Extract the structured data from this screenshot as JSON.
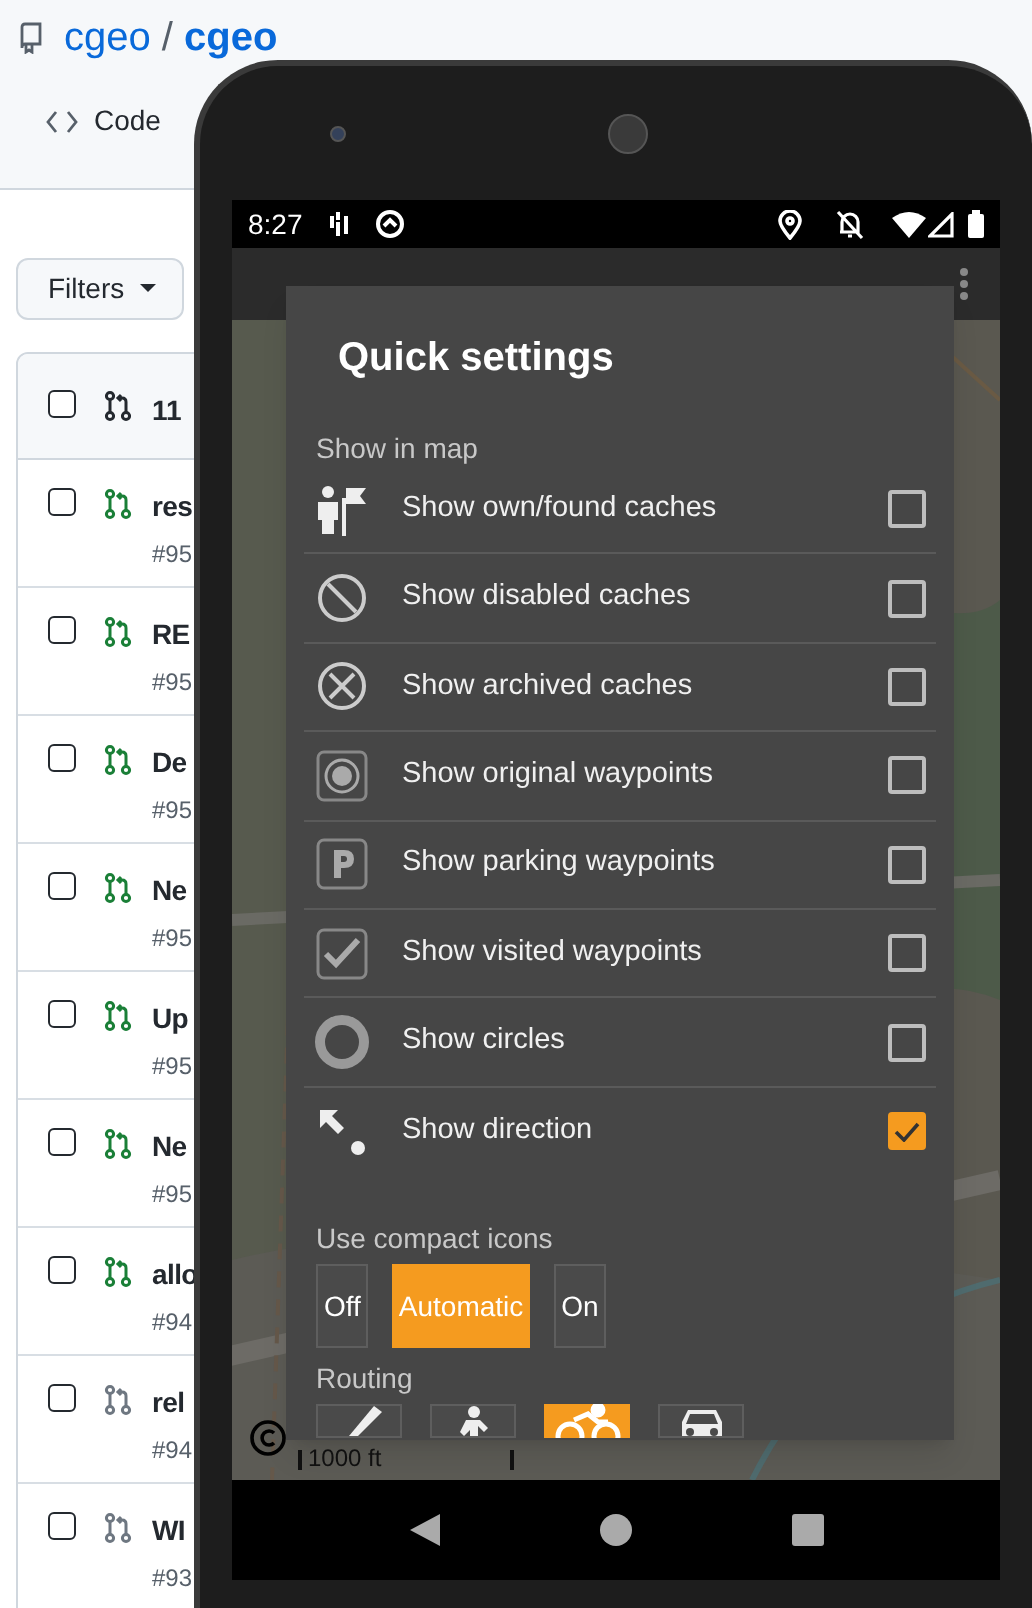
{
  "repo": {
    "owner": "cgeo",
    "separator": "/",
    "name": "cgeo"
  },
  "repo_tab": "Code",
  "filters_button": "Filters",
  "pull_requests": {
    "header": {
      "text": "11",
      "checked": false
    },
    "rows": [
      {
        "title": "res",
        "number": "#95",
        "kind": "open",
        "checked": false
      },
      {
        "title": "RE",
        "number": "#95",
        "kind": "open",
        "checked": false
      },
      {
        "title": "De",
        "number": "#95",
        "kind": "open",
        "checked": false
      },
      {
        "title": "Ne",
        "number": "#95",
        "kind": "open",
        "checked": false
      },
      {
        "title": "Up",
        "number": "#95",
        "kind": "open",
        "checked": false
      },
      {
        "title": "Ne",
        "number": "#95",
        "kind": "open",
        "checked": false
      },
      {
        "title": "allo",
        "number": "#94",
        "kind": "open",
        "checked": false
      },
      {
        "title": "rel",
        "number": "#94",
        "kind": "draft",
        "checked": false
      },
      {
        "title": "WI",
        "number": "#93",
        "kind": "draft",
        "checked": false
      }
    ]
  },
  "phone": {
    "status_bar": {
      "time": "8:27"
    },
    "map": {
      "scale": "1000 ft"
    },
    "dialog": {
      "title": "Quick settings",
      "section": "Show in map",
      "items": [
        {
          "kind": "own",
          "label": "Show own/found caches",
          "checked": false
        },
        {
          "kind": "disabled",
          "label": "Show disabled caches",
          "checked": false
        },
        {
          "kind": "archived",
          "label": "Show archived caches",
          "checked": false
        },
        {
          "kind": "original",
          "label": "Show original waypoints",
          "checked": false
        },
        {
          "kind": "parking",
          "label": "Show parking waypoints",
          "checked": false
        },
        {
          "kind": "visited",
          "label": "Show visited waypoints",
          "checked": false
        },
        {
          "kind": "circles",
          "label": "Show circles",
          "checked": false
        },
        {
          "kind": "direction",
          "label": "Show direction",
          "checked": true
        }
      ],
      "compact_icons": {
        "label": "Use compact icons",
        "options": [
          {
            "label": "Off",
            "selected": false
          },
          {
            "label": "Automatic",
            "selected": true
          },
          {
            "label": "On",
            "selected": false
          }
        ]
      },
      "routing": {
        "label": "Routing",
        "options": [
          {
            "kind": "straight",
            "selected": false
          },
          {
            "kind": "walk",
            "selected": false
          },
          {
            "kind": "bike",
            "selected": true
          },
          {
            "kind": "car",
            "selected": false
          }
        ]
      }
    }
  }
}
